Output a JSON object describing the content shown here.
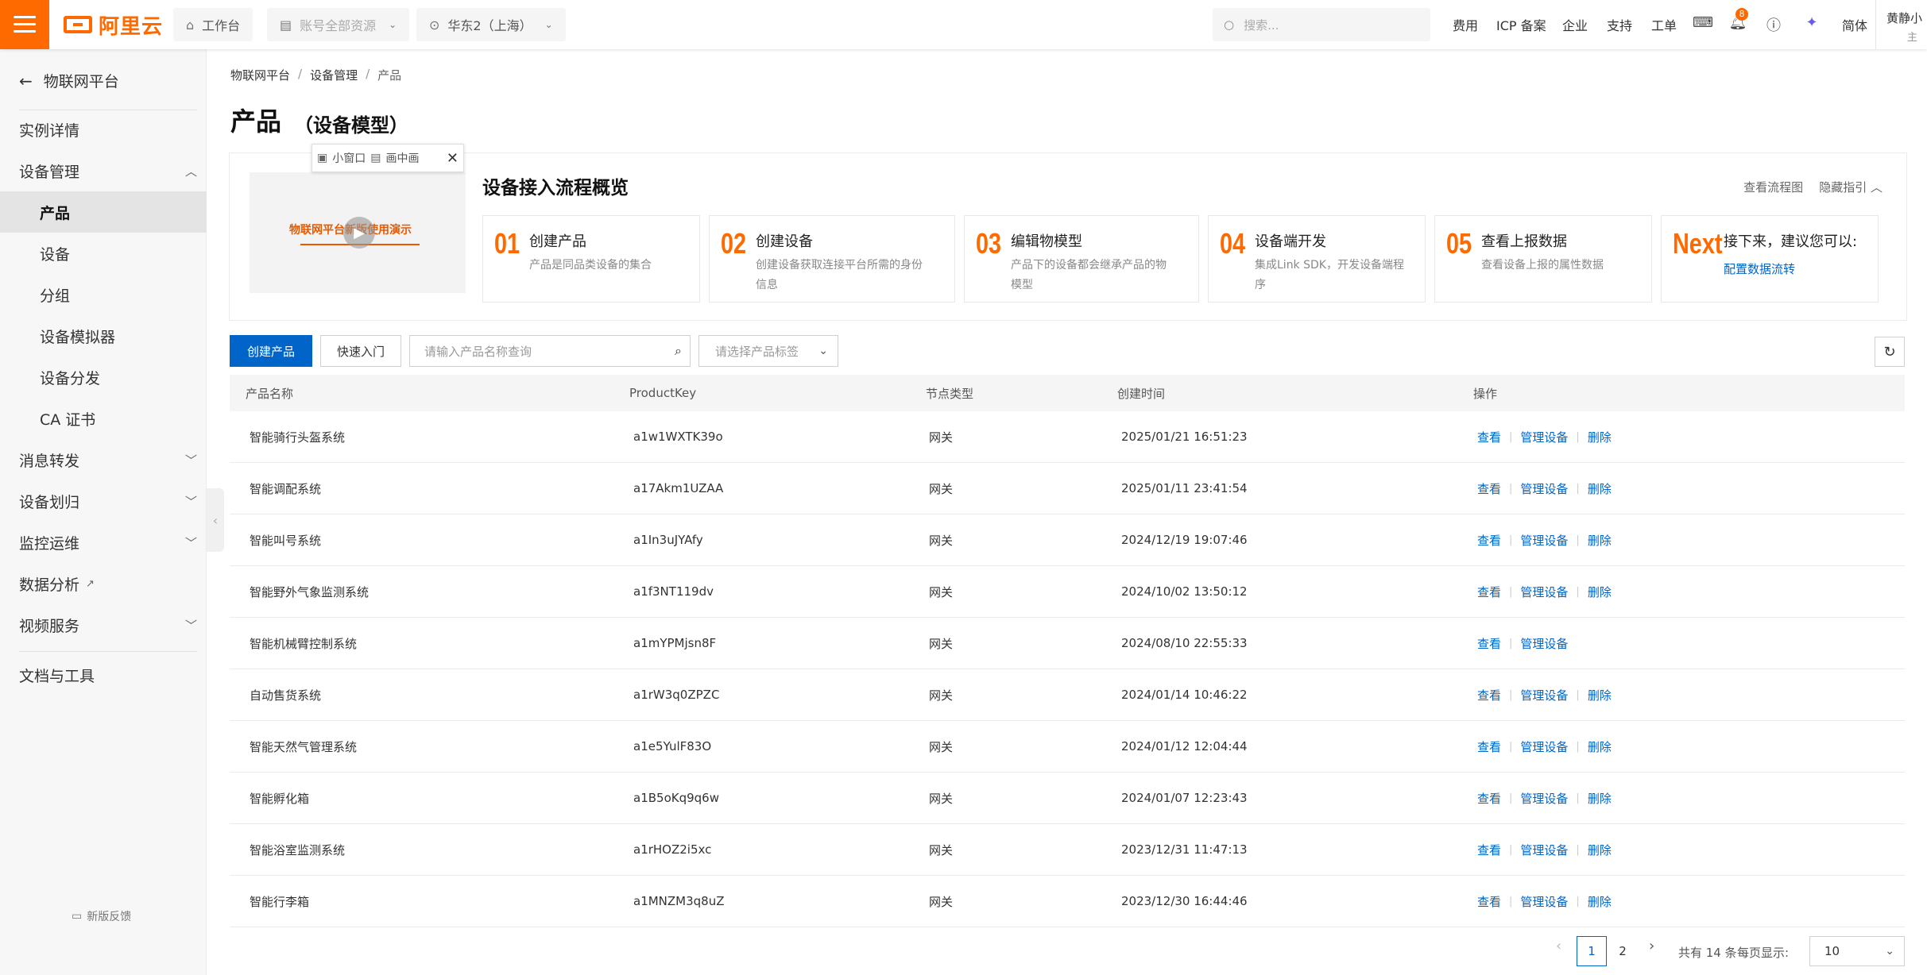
{
  "topbar": {
    "logo_text": "阿里云",
    "workbench": "工作台",
    "account_resources": "账号全部资源",
    "region": "华东2（上海）",
    "search_placeholder": "搜索...",
    "links": [
      "费用",
      "ICP 备案",
      "企业",
      "支持",
      "工单"
    ],
    "notification_count": "8",
    "language": "简体",
    "user_name": "黄静小",
    "user_sub": "主"
  },
  "sidebar": {
    "back_label": "物联网平台",
    "items": [
      {
        "label": "实例详情"
      },
      {
        "label": "设备管理"
      },
      {
        "label": "产品"
      },
      {
        "label": "设备"
      },
      {
        "label": "分组"
      },
      {
        "label": "设备模拟器"
      },
      {
        "label": "设备分发"
      },
      {
        "label": "CA 证书"
      },
      {
        "label": "消息转发"
      },
      {
        "label": "设备划归"
      },
      {
        "label": "监控运维"
      },
      {
        "label": "数据分析"
      },
      {
        "label": "视频服务"
      },
      {
        "label": "文档与工具"
      }
    ],
    "feedback": "新版反馈"
  },
  "breadcrumb": [
    "物联网平台",
    "设备管理",
    "产品"
  ],
  "page": {
    "title": "产品",
    "subtitle": "（设备模型）"
  },
  "guide": {
    "video_title": "物联网平台新版使用演示",
    "pip_small_window": "小窗口",
    "pip_picture_in_picture": "画中画",
    "title": "设备接入流程概览",
    "view_flowchart": "查看流程图",
    "hide_guide": "隐藏指引",
    "steps": [
      {
        "num": "01",
        "title": "创建产品",
        "desc": "产品是同品类设备的集合",
        "desc2": ""
      },
      {
        "num": "02",
        "title": "创建设备",
        "desc": "创建设备获取连接平台所需的身份",
        "desc2": "信息"
      },
      {
        "num": "03",
        "title": "编辑物模型",
        "desc": "产品下的设备都会继承产品的物",
        "desc2": "模型"
      },
      {
        "num": "04",
        "title": "设备端开发",
        "desc": "集成Link SDK，开发设备端程",
        "desc2": "序"
      },
      {
        "num": "05",
        "title": "查看上报数据",
        "desc": "查看设备上报的属性数据",
        "desc2": ""
      },
      {
        "num": "Next",
        "title": "接下来，建议您可以:",
        "link": "配置数据流转"
      }
    ]
  },
  "toolbar": {
    "create_product": "创建产品",
    "quick_start": "快速入门",
    "search_placeholder": "请输入产品名称查询",
    "tag_placeholder": "请选择产品标签"
  },
  "table": {
    "headers": [
      "产品名称",
      "ProductKey",
      "节点类型",
      "创建时间",
      "操作"
    ],
    "op_view": "查看",
    "op_manage": "管理设备",
    "op_delete": "删除",
    "rows": [
      {
        "name": "智能骑行头盔系统",
        "key": "a1w1WXTK39o",
        "type": "网关",
        "time": "2025/01/21 16:51:23",
        "deletable": true
      },
      {
        "name": "智能调配系统",
        "key": "a17Akm1UZAA",
        "type": "网关",
        "time": "2025/01/11 23:41:54",
        "deletable": true
      },
      {
        "name": "智能叫号系统",
        "key": "a1In3uJYAfy",
        "type": "网关",
        "time": "2024/12/19 19:07:46",
        "deletable": true
      },
      {
        "name": "智能野外气象监测系统",
        "key": "a1f3NT119dv",
        "type": "网关",
        "time": "2024/10/02 13:50:12",
        "deletable": true
      },
      {
        "name": "智能机械臂控制系统",
        "key": "a1mYPMjsn8F",
        "type": "网关",
        "time": "2024/08/10 22:55:33",
        "deletable": false
      },
      {
        "name": "自动售货系统",
        "key": "a1rW3q0ZPZC",
        "type": "网关",
        "time": "2024/01/14 10:46:22",
        "deletable": true
      },
      {
        "name": "智能天然气管理系统",
        "key": "a1e5YulF83O",
        "type": "网关",
        "time": "2024/01/12 12:04:44",
        "deletable": true
      },
      {
        "name": "智能孵化箱",
        "key": "a1B5oKq9q6w",
        "type": "网关",
        "time": "2024/01/07 12:23:43",
        "deletable": true
      },
      {
        "name": "智能浴室监测系统",
        "key": "a1rHOZ2i5xc",
        "type": "网关",
        "time": "2023/12/31 11:47:13",
        "deletable": true
      },
      {
        "name": "智能行李箱",
        "key": "a1MNZM3q8uZ",
        "type": "网关",
        "time": "2023/12/30 16:44:46",
        "deletable": true
      }
    ]
  },
  "pagination": {
    "pages": [
      "1",
      "2"
    ],
    "current": "1",
    "total_text": "共有 14 条",
    "page_size_label": "每页显示:",
    "page_size": "10"
  },
  "colors": {
    "brand": "#ff6a00",
    "primary": "#0064c8"
  }
}
